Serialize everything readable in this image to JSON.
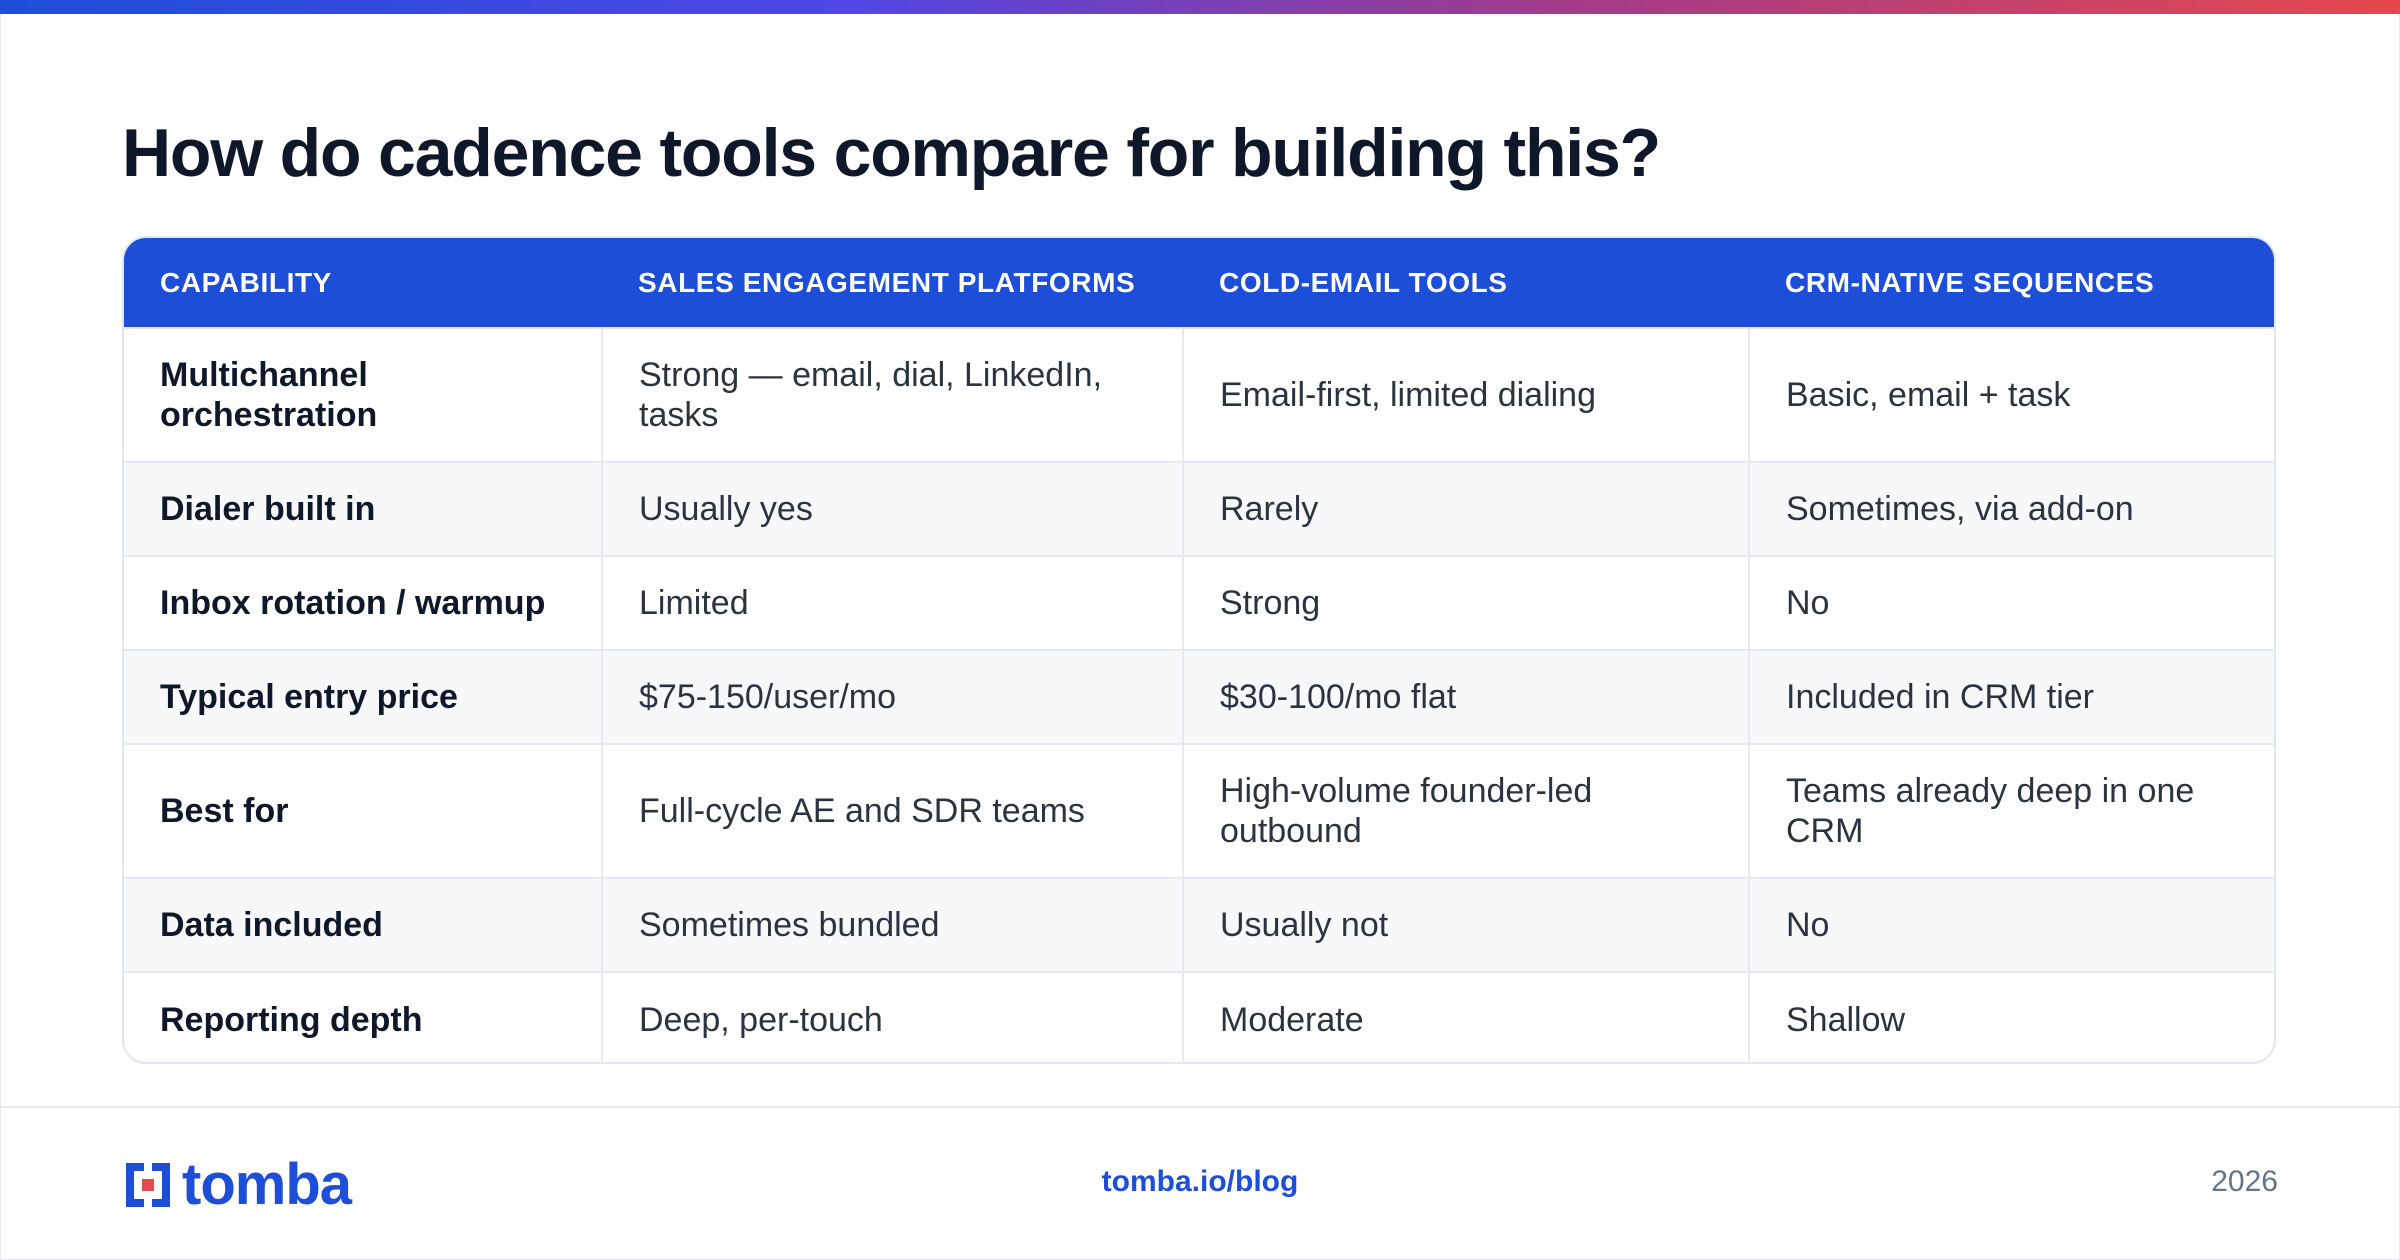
{
  "title": "How do cadence tools compare for building this?",
  "colors": {
    "accent": "#1d4ed8",
    "gradient": [
      "#1d4ed8",
      "#4f46e5",
      "#a23b8a",
      "#e5484d"
    ],
    "alt_row": "#f7f8fa"
  },
  "table": {
    "headers": [
      "CAPABILITY",
      "SALES ENGAGEMENT PLATFORMS",
      "COLD-EMAIL TOOLS",
      "CRM-NATIVE SEQUENCES"
    ],
    "rows": [
      [
        "Multichannel orchestration",
        "Strong — email, dial, LinkedIn, tasks",
        "Email-first, limited dialing",
        "Basic, email + task"
      ],
      [
        "Dialer built in",
        "Usually yes",
        "Rarely",
        "Sometimes, via add-on"
      ],
      [
        "Inbox rotation / warmup",
        "Limited",
        "Strong",
        "No"
      ],
      [
        "Typical entry price",
        "$75-150/user/mo",
        "$30-100/mo flat",
        "Included in CRM tier"
      ],
      [
        "Best for",
        "Full-cycle AE and SDR teams",
        "High-volume founder-led outbound",
        "Teams already deep in one CRM"
      ],
      [
        "Data included",
        "Sometimes bundled",
        "Usually not",
        "No"
      ],
      [
        "Reporting depth",
        "Deep, per-touch",
        "Moderate",
        "Shallow"
      ]
    ]
  },
  "footer": {
    "logo_text": "tomba",
    "logo_icon": "tomba-bracket-logo-icon",
    "link": "tomba.io/blog",
    "year": "2026"
  }
}
